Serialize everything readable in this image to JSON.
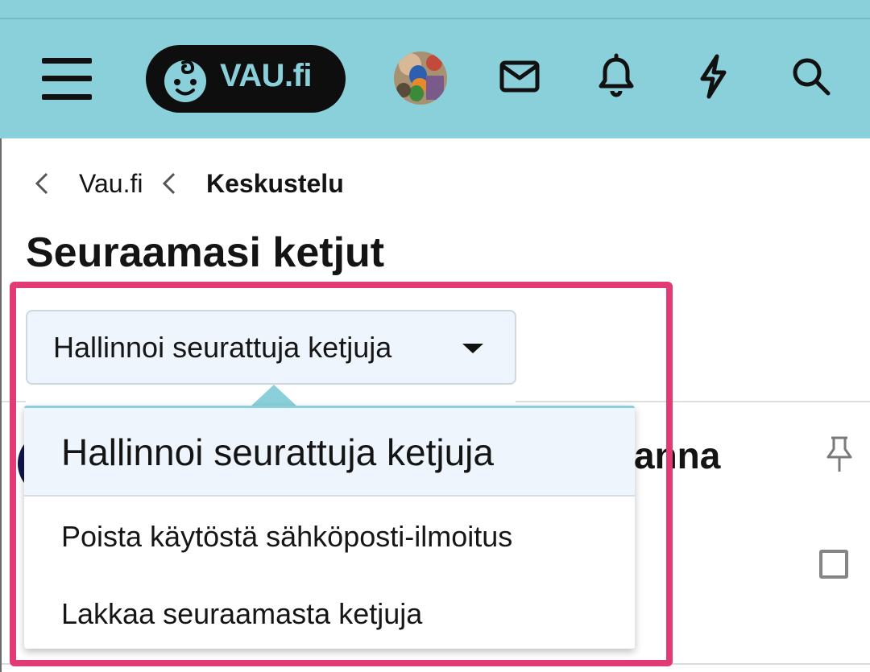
{
  "header": {
    "logo_text": "VAU.fi",
    "icons": [
      "menu-icon",
      "envelope-icon",
      "bell-icon",
      "lightning-icon",
      "search-icon"
    ]
  },
  "breadcrumb": {
    "items": [
      "Vau.fi",
      "Keskustelu"
    ]
  },
  "page": {
    "title": "Seuraamasi ketjut",
    "manage_button_label": "Hallinnoi seurattuja ketjuja"
  },
  "dropdown": {
    "header": "Hallinnoi seurattuja ketjuja",
    "items": [
      "Poista käytöstä sähköposti-ilmoitus",
      "Lakkaa seuraamasta ketjuja"
    ]
  },
  "background": {
    "partial_thread_title": "anna"
  },
  "colors": {
    "header_bg": "#8ad0da",
    "highlight": "#e13a75",
    "button_bg": "#eef5fc"
  }
}
